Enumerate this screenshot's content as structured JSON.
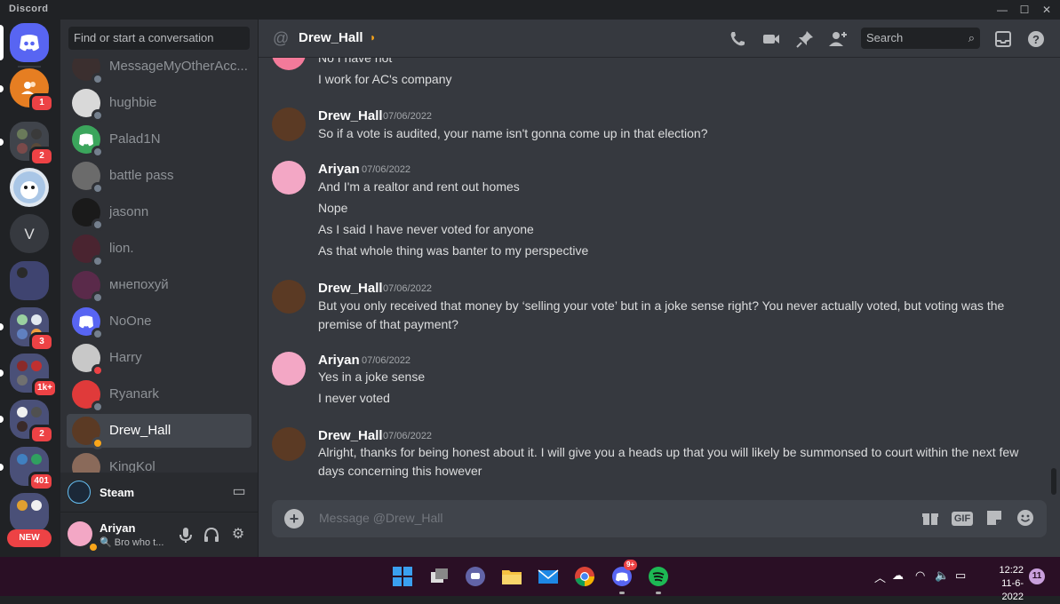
{
  "app": {
    "title": "Discord"
  },
  "window_controls": {
    "minimize": "—",
    "maximize": "☐",
    "close": "✕"
  },
  "guilds": {
    "items": [
      {
        "name": "Direct Messages",
        "badge": ""
      },
      {
        "name": "Friend group",
        "badge": "1"
      },
      {
        "name": "Server folder",
        "badge": "2"
      },
      {
        "name": "Shark server",
        "badge": ""
      },
      {
        "name": "V",
        "badge": ""
      },
      {
        "name": "Dark server",
        "badge": ""
      },
      {
        "name": "Folder",
        "badge": "3"
      },
      {
        "name": "Folder",
        "badge": "1k+"
      },
      {
        "name": "Folder",
        "badge": "2"
      },
      {
        "name": "Folder",
        "badge": "401"
      },
      {
        "name": "Folder",
        "badge": ""
      }
    ],
    "new_label": "NEW"
  },
  "dm_sidebar": {
    "search_placeholder": "Find or start a conversation",
    "items": [
      {
        "name": "MessageMyOtherAcc...",
        "color": "#3b2f2f",
        "status": "offline"
      },
      {
        "name": "hughbie",
        "color": "#d9d9d9",
        "status": "offline"
      },
      {
        "name": "Palad1N",
        "color": "#3ba55c",
        "status": "offline"
      },
      {
        "name": "battle pass",
        "color": "#6b6b6b",
        "status": "offline"
      },
      {
        "name": "jasonn",
        "color": "#1a1a1a",
        "status": "offline"
      },
      {
        "name": "lion.",
        "color": "#4a2430",
        "status": "offline"
      },
      {
        "name": "мнепохуй",
        "color": "#5a2a4a",
        "status": "offline"
      },
      {
        "name": "NoOne",
        "color": "#5865f2",
        "status": "offline"
      },
      {
        "name": "Harry",
        "color": "#c8c8c8",
        "status": "dnd"
      },
      {
        "name": "Ryanark",
        "color": "#e03a3a",
        "status": "offline"
      },
      {
        "name": "Drew_Hall",
        "color": "#5b3a24",
        "status": "idle",
        "active": true
      },
      {
        "name": "KingKol",
        "color": "#8a6a5a",
        "status": "offline"
      }
    ],
    "steam_label": "Steam",
    "user": {
      "name": "Ariyan",
      "status": "🔍 Bro who t...",
      "color": "#f3a7c5"
    }
  },
  "header": {
    "title": "Drew_Hall",
    "search_placeholder": "Search",
    "icons": [
      "phone-call-icon",
      "video-call-icon",
      "pin-icon",
      "add-friend-icon",
      "inbox-icon",
      "help-icon"
    ]
  },
  "messages": [
    {
      "lines": [
        "No I have not",
        "I work for AC's company"
      ]
    },
    {
      "author": "Drew_Hall",
      "time": "07/06/2022",
      "lines": [
        "So if a vote is audited, your name isn't gonna come up in that election?"
      ]
    },
    {
      "author": "Ariyan",
      "time": "07/06/2022",
      "lines": [
        "And I'm a realtor and rent out  homes",
        "Nope",
        "As I said I have never voted for anyone",
        "As that whole thing was banter to my perspective"
      ]
    },
    {
      "author": "Drew_Hall",
      "time": "07/06/2022",
      "lines": [
        "But you only received that money by ‘selling your vote’ but in a joke sense right? You never actually voted, but voting was the premise of that payment?"
      ]
    },
    {
      "author": "Ariyan",
      "time": "07/06/2022",
      "lines": [
        "Yes in a joke sense",
        "I never voted"
      ]
    },
    {
      "author": "Drew_Hall",
      "time": "07/06/2022",
      "lines": [
        "Alright, thanks for being honest about it. I will give you a heads up that you will likely be summonsed to court within the next few days concerning this however"
      ]
    }
  ],
  "composer": {
    "placeholder": "Message @Drew_Hall",
    "gif_label": "GIF"
  },
  "taskbar": {
    "discord_badge": "9+",
    "time": "12:22",
    "date": "11-6-2022",
    "notifications": "11"
  },
  "colors": {
    "accent": "#5865f2",
    "danger": "#ed4245",
    "idle": "#faa61a",
    "online": "#3ba55c"
  }
}
